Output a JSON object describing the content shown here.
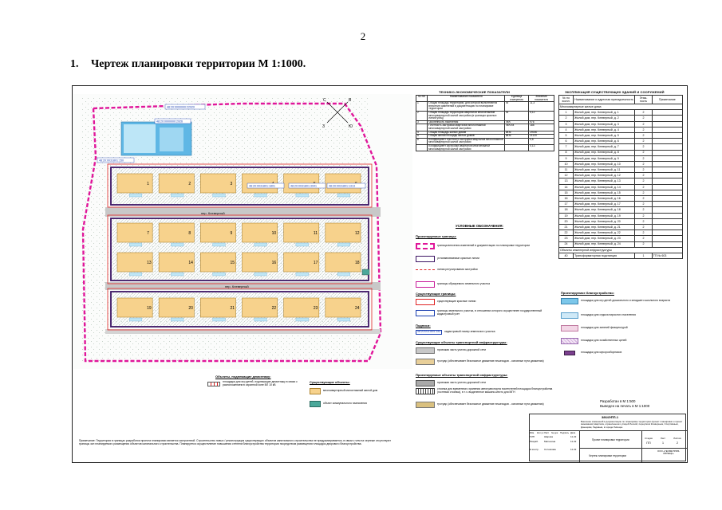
{
  "page_number": "2",
  "heading": {
    "number": "1.",
    "text": "Чертеж планировки территории М 1:1000."
  },
  "plan": {
    "street_labels": [
      "пер. Клеверный",
      "пер. Клеверный"
    ],
    "cadastral_labels": [
      "48:20:0000000:22920",
      "48:20:0000000:2926",
      "48:20:0031801:150",
      "48:20:0031801:1801",
      "48:20:0031801:3941",
      "48:20:0031801:1313"
    ],
    "north_labels": {
      "n": "С",
      "s": "Ю",
      "w": "З",
      "e": "В"
    },
    "block1_numbers": [
      "1",
      "2",
      "3",
      "4",
      "5",
      "6"
    ],
    "block2_numbers": [
      "7",
      "8",
      "9",
      "10",
      "11",
      "12",
      "13",
      "14",
      "15",
      "16",
      "17",
      "18"
    ],
    "block3_numbers": [
      "19",
      "20",
      "21",
      "22",
      "23",
      "24"
    ],
    "substation_label": "40"
  },
  "tech_table": {
    "title": "ТЕХНИКО-ЭКОНОМИЧЕСКИЕ ПОКАЗАТЕЛИ",
    "headers": [
      "№ п/п",
      "Наименование показателя",
      "Единица измерения",
      "Значение показателя"
    ],
    "rows": [
      [
        "1",
        "Общая площадь территории, для которой выполняются внесение изменений в документацию по планировке территории",
        "га",
        "11,3"
      ],
      [
        "2",
        "Общая площадь территории кварталов многоэтажной многоквартирной жилой застройки (в границах красных линий улиц)",
        "га",
        "5,12"
      ],
      [
        "3",
        "Численность населения",
        "чел.",
        "976"
      ],
      [
        "",
        "Плотность застройки кварталов многоэтажной многоквартирной жилой застройки",
        "чел./га",
        "188"
      ],
      [
        "4",
        "Общая площадь жилых домов",
        "кв.м",
        "29000"
      ],
      [
        "5",
        "Общая жилая площадь жилых домов",
        "кв.м",
        "21120"
      ],
      [
        "6",
        "Коэффициент плотности застройки кварталов многоэтажной многоквартирной жилой застройки",
        "",
        "0,6"
      ],
      [
        "",
        "Коэффициент застройки кварталов многоэтажной многоквартирной жилой застройки",
        "",
        "0,13"
      ]
    ]
  },
  "buildings_table": {
    "title": "ЭКСПЛИКАЦИЯ СУЩЕСТВУЮЩИХ ЗДАНИЙ И СООРУЖЕНИЙ",
    "headers": [
      "№ по экспл.",
      "Наименование и адресная принадлежность",
      "Этаж-ность",
      "Примечание"
    ],
    "group1": "Многоквартирные жилые дома",
    "rows": [
      [
        "1",
        "Жилой дом, пер. Клеверный, д. 1",
        "2"
      ],
      [
        "2",
        "Жилой дом, пер. Клеверный, д. 2",
        "2"
      ],
      [
        "3",
        "Жилой дом, пер. Клеверный, д. 3",
        "2"
      ],
      [
        "4",
        "Жилой дом, пер. Клеверный, д. 4",
        "2"
      ],
      [
        "5",
        "Жилой дом, пер. Клеверный, д. 5",
        "2"
      ],
      [
        "6",
        "Жилой дом, пер. Клеверный, д. 6",
        "2"
      ],
      [
        "7",
        "Жилой дом, пер. Клеверный, д. 7",
        "2"
      ],
      [
        "8",
        "Жилой дом, пер. Клеверный, д. 8",
        "2"
      ],
      [
        "9",
        "Жилой дом, пер. Клеверный, д. 9",
        "2"
      ],
      [
        "10",
        "Жилой дом, пер. Клеверный, д. 10",
        "2"
      ],
      [
        "11",
        "Жилой дом, пер. Клеверный, д. 11",
        "2"
      ],
      [
        "12",
        "Жилой дом, пер. Клеверный, д. 12",
        "2"
      ],
      [
        "13",
        "Жилой дом, пер. Клеверный, д. 13",
        "2"
      ],
      [
        "14",
        "Жилой дом, пер. Клеверный, д. 14",
        "2"
      ],
      [
        "15",
        "Жилой дом, пер. Клеверный, д. 15",
        "2"
      ],
      [
        "16",
        "Жилой дом, пер. Клеверный, д. 16",
        "2"
      ],
      [
        "17",
        "Жилой дом, пер. Клеверный, д. 17",
        "2"
      ],
      [
        "18",
        "Жилой дом, пер. Клеверный, д. 18",
        "2"
      ],
      [
        "19",
        "Жилой дом, пер. Клеверный, д. 19",
        "2"
      ],
      [
        "20",
        "Жилой дом, пер. Клеверный, д. 20",
        "2"
      ],
      [
        "21",
        "Жилой дом, пер. Клеверный, д. 21",
        "2"
      ],
      [
        "22",
        "Жилой дом, пер. Клеверный, д. 22",
        "2"
      ],
      [
        "23",
        "Жилой дом, пер. Клеверный, д. 23",
        "2"
      ],
      [
        "24",
        "Жилой дом, пер. Клеверный, д. 24",
        "2"
      ]
    ],
    "group2": "Объекты инженерной инфраструктуры",
    "last_row": [
      "40",
      "Трансформаторная подстанция",
      "1",
      "ТП № 603"
    ]
  },
  "legend": {
    "title": "УСЛОВНЫЕ ОБОЗНАЧЕНИЯ:",
    "designed_cap": "Проектируемые границы:",
    "designed": [
      "граница внесения изменений в документацию по планировке территории",
      "устанавливаемые красные линии",
      "линия регулирования застройки",
      "границы образуемого земельного участка"
    ],
    "existing_cap": "Существующие границы:",
    "existing": [
      "существующие красные линии",
      "границы земельного участка, в отношении которого осуществлен государственный кадастровый учет"
    ],
    "captions_cap": "Подписи:",
    "caption_sample": "48:20:0031801:182",
    "caption_text": "кадастровый номер земельного участка",
    "transport_existing_cap": "Существующие объекты транспортной инфраструктуры:",
    "transport_existing": [
      "проезжая часть улично-дорожной сети",
      "тротуар (обеспечивает безопасное движение пешеходов - основные пути движения)"
    ],
    "transport_designed_cap": "Проектируемые объекты транспортной инфраструктуры:",
    "transport_designed": [
      "проезжая часть улично-дорожной сети",
      "стоянка для временного хранения автотранспорта посетителей площадок благоустройства (гостевая стоянка), в т.ч. выделенное машино-место для МГН",
      "тротуар (обеспечивает безопасное движение пешеходов - основные пути движения)"
    ],
    "landscape_cap": "Проектируемое благоустройство:",
    "landscape": [
      "площадки для игр детей дошкольного и младшего школьного возраста",
      "площадки для отдыха взрослого населения",
      "площадки для занятий физкультурой",
      "площадки для хозяйственных целей",
      "площадки для мусоросборников"
    ],
    "objects_cap": "Объекты, подлежащие демонтажу:",
    "objects_text": "площадки для игр детей, подлежащие демонтажу в связи с расположением в охранной зоне ВЛ 10 кВ",
    "existing_obj_cap": "Существующие объекты:",
    "existing_obj": [
      "многоквартирный малоэтажный жилой дом",
      "объект коммунального назначения"
    ]
  },
  "colors": {
    "boundary_magenta": "#e0169a",
    "red_line": "#e02424",
    "block_border": "#3c1464",
    "house_fill": "#f7d28c",
    "road": "#c8c8c8",
    "playground": "#bfe6f5",
    "recreation": "#ddeff9",
    "sport": "#f3d6e6",
    "utility": "#e8d6ee",
    "trash": "#7b3f8f"
  },
  "scale_note": {
    "line1": "Разработан в М 1:500",
    "line2": "Выведен на печать в М 1:1000"
  },
  "note": "Примечание: Территория в границах разработки проекта планировки является застроенной. Строительство новых / реконструкция существующих объектов капитального строительства не предусматривается, в связи с чем на чертеже отсутствуют границы зон планируемого размещения объектов капитального строительства. Планируется осуществление повышения степени благоустройства территории посредством размещения площадок дворового благоустройства.",
  "stamp": {
    "code": "3864ЭПП-1",
    "description": "Внесение изменений в документацию по планировке территории (проект планировки и проект межевания) квартала, ограниченного улицей Лесной, переулком Клеверным, Спортивным, Донецким, Ледовым, в городе Липецке",
    "roles": [
      [
        "ГИП",
        "Шарова"
      ],
      [
        "Разраб.",
        "Матюхина"
      ],
      [
        "Н.контр.",
        "Сотникова"
      ]
    ],
    "head_cells": [
      "Изм.",
      "Кол.уч",
      "Лист",
      "№ док.",
      "Подпись",
      "Дата"
    ],
    "date": "11.22",
    "sheet_title_1": "Проект планировки территории",
    "stage_headers": [
      "Стадия",
      "Лист",
      "Листов"
    ],
    "stage_values": [
      "ПП",
      "1",
      "2"
    ],
    "sheet_title_2": "Чертеж планировки территории",
    "company": "ООО «ГЕОМЕТРИЯ-ЛИПЕЦК»"
  }
}
